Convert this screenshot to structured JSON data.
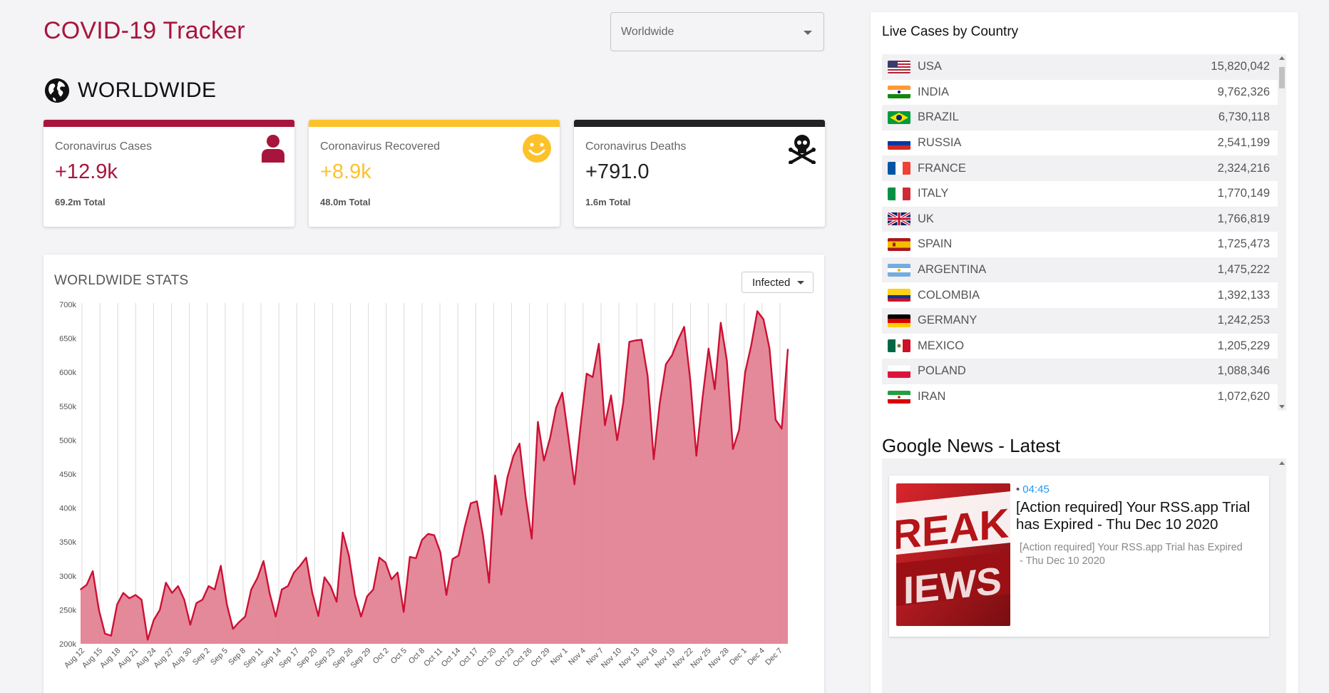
{
  "header": {
    "title": "COVID-19 Tracker",
    "country_select": "Worldwide"
  },
  "section": {
    "heading": "WORLDWIDE",
    "icon": "globe-icon"
  },
  "cards": [
    {
      "label": "Coronavirus Cases",
      "today": "+12.9k",
      "total": "69.2m Total",
      "color": "#a8153c",
      "icon": "person-icon"
    },
    {
      "label": "Coronavirus Recovered",
      "today": "+8.9k",
      "total": "48.0m Total",
      "color": "#fdc22b",
      "icon": "smiley-icon"
    },
    {
      "label": "Coronavirus Deaths",
      "today": "+791.0",
      "total": "1.6m Total",
      "color": "#222222",
      "icon": "skull-crossbones-icon"
    }
  ],
  "chart_panel": {
    "title": "WORLDWIDE STATS",
    "type_select": "Infected"
  },
  "chart_data": {
    "type": "area",
    "title": "",
    "xlabel": "",
    "ylabel": "",
    "ylim": [
      200000,
      700000
    ],
    "y_ticks": [
      "200k",
      "250k",
      "300k",
      "350k",
      "400k",
      "450k",
      "500k",
      "550k",
      "600k",
      "650k",
      "700k"
    ],
    "x_ticks": [
      "Aug 12",
      "Aug 15",
      "Aug 18",
      "Aug 21",
      "Aug 24",
      "Aug 27",
      "Aug 30",
      "Sep 2",
      "Sep 5",
      "Sep 8",
      "Sep 11",
      "Sep 14",
      "Sep 17",
      "Sep 20",
      "Sep 23",
      "Sep 26",
      "Sep 29",
      "Oct 2",
      "Oct 5",
      "Oct 8",
      "Oct 11",
      "Oct 14",
      "Oct 17",
      "Oct 20",
      "Oct 23",
      "Oct 26",
      "Oct 29",
      "Nov 1",
      "Nov 4",
      "Nov 7",
      "Nov 10",
      "Nov 13",
      "Nov 16",
      "Nov 19",
      "Nov 22",
      "Nov 25",
      "Nov 28",
      "Dec 1",
      "Dec 4",
      "Dec 7"
    ],
    "fill_color": "#e38394",
    "line_color": "#cc1034",
    "grid": "vertical",
    "values": [
      280000,
      287000,
      307000,
      250000,
      215000,
      212000,
      258000,
      275000,
      267000,
      272000,
      265000,
      206000,
      235000,
      250000,
      290000,
      275000,
      285000,
      265000,
      228000,
      260000,
      265000,
      285000,
      280000,
      315000,
      258000,
      222000,
      232000,
      240000,
      280000,
      297000,
      322000,
      275000,
      240000,
      280000,
      285000,
      305000,
      315000,
      327000,
      275000,
      241000,
      298000,
      285000,
      262000,
      364000,
      330000,
      272000,
      240000,
      270000,
      280000,
      327000,
      320000,
      295000,
      305000,
      247000,
      328000,
      326000,
      353000,
      362000,
      360000,
      335000,
      272000,
      325000,
      330000,
      372000,
      407000,
      410000,
      360000,
      290000,
      448000,
      390000,
      445000,
      477000,
      495000,
      416000,
      355000,
      527000,
      470000,
      503000,
      548000,
      570000,
      505000,
      435000,
      520000,
      598000,
      593000,
      642000,
      522000,
      566000,
      500000,
      555000,
      645000,
      647000,
      648000,
      595000,
      472000,
      555000,
      612000,
      625000,
      648000,
      667000,
      588000,
      477000,
      562000,
      635000,
      575000,
      673000,
      617000,
      487000,
      515000,
      600000,
      640000,
      690000,
      678000,
      635000,
      530000,
      517000,
      634000
    ]
  },
  "live_cases": {
    "title": "Live Cases by Country",
    "rows": [
      {
        "country": "USA",
        "cases": "15,820,042",
        "flag": "us"
      },
      {
        "country": "INDIA",
        "cases": "9,762,326",
        "flag": "in"
      },
      {
        "country": "BRAZIL",
        "cases": "6,730,118",
        "flag": "br"
      },
      {
        "country": "RUSSIA",
        "cases": "2,541,199",
        "flag": "ru"
      },
      {
        "country": "FRANCE",
        "cases": "2,324,216",
        "flag": "fr"
      },
      {
        "country": "ITALY",
        "cases": "1,770,149",
        "flag": "it"
      },
      {
        "country": "UK",
        "cases": "1,766,819",
        "flag": "gb"
      },
      {
        "country": "SPAIN",
        "cases": "1,725,473",
        "flag": "es"
      },
      {
        "country": "ARGENTINA",
        "cases": "1,475,222",
        "flag": "ar"
      },
      {
        "country": "COLOMBIA",
        "cases": "1,392,133",
        "flag": "co"
      },
      {
        "country": "GERMANY",
        "cases": "1,242,253",
        "flag": "de"
      },
      {
        "country": "MEXICO",
        "cases": "1,205,229",
        "flag": "mx"
      },
      {
        "country": "POLAND",
        "cases": "1,088,346",
        "flag": "pl"
      },
      {
        "country": "IRAN",
        "cases": "1,072,620",
        "flag": "ir"
      }
    ]
  },
  "news": {
    "title": "Google News - Latest",
    "items": [
      {
        "time": "04:45",
        "headline": "[Action required] Your RSS.app Trial has Expired - Thu Dec 10 2020",
        "description": "[Action required] Your RSS.app Trial has Expired - Thu Dec 10 2020",
        "image_text_1": "REAKI",
        "image_text_2": "IEWS"
      }
    ]
  }
}
